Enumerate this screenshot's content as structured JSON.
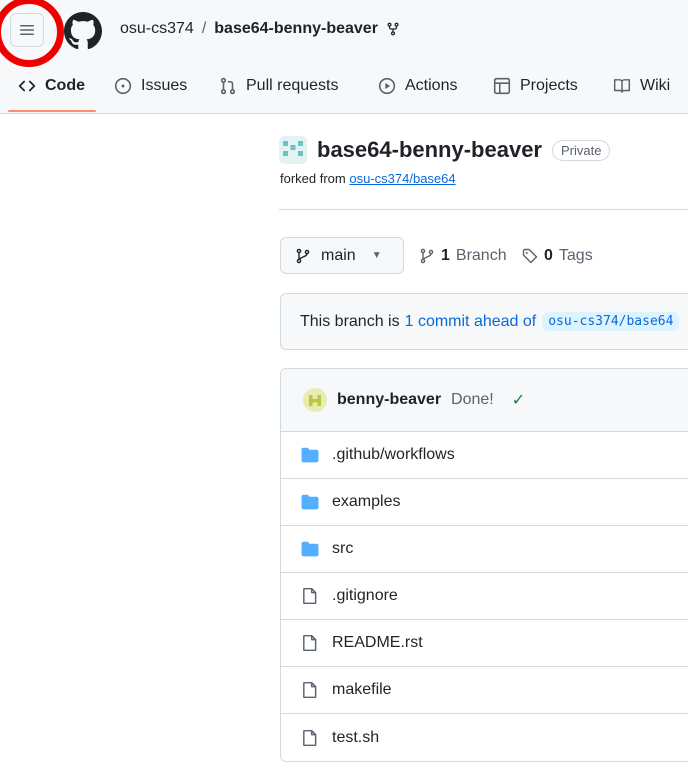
{
  "header": {
    "owner": "osu-cs374",
    "separator": "/",
    "repo": "base64-benny-beaver"
  },
  "tabs": [
    {
      "label": "Code",
      "icon": "code-icon",
      "active": true
    },
    {
      "label": "Issues",
      "icon": "issue-icon"
    },
    {
      "label": "Pull requests",
      "icon": "pull-request-icon"
    },
    {
      "label": "Actions",
      "icon": "play-icon"
    },
    {
      "label": "Projects",
      "icon": "table-icon"
    },
    {
      "label": "Wiki",
      "icon": "book-icon"
    }
  ],
  "repo": {
    "name": "base64-benny-beaver",
    "visibility": "Private",
    "forked_prefix": "forked from",
    "forked_from": "osu-cs374/base64"
  },
  "branch": {
    "current": "main",
    "branch_count": "1",
    "branch_label": "Branch",
    "tag_count": "0",
    "tag_label": "Tags"
  },
  "ahead": {
    "prefix": "This branch is",
    "link": "1 commit ahead of",
    "ref": "osu-cs374/base64"
  },
  "commit": {
    "author": "benny-beaver",
    "message": "Done!",
    "status": "✓"
  },
  "files": [
    {
      "name": ".github/workflows",
      "type": "folder"
    },
    {
      "name": "examples",
      "type": "folder"
    },
    {
      "name": "src",
      "type": "folder"
    },
    {
      "name": ".gitignore",
      "type": "file"
    },
    {
      "name": "README.rst",
      "type": "file"
    },
    {
      "name": "makefile",
      "type": "file"
    },
    {
      "name": "test.sh",
      "type": "file"
    }
  ],
  "colors": {
    "accent_underline": "#fd8c73",
    "link": "#0969da",
    "folder": "#54aeff",
    "highlight_ring": "#ee0000",
    "success": "#1a7f37"
  }
}
